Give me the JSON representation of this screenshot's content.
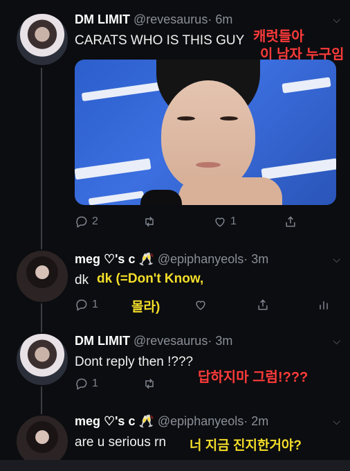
{
  "tweets": [
    {
      "name": "DM LIMIT",
      "handle": "@revesaurus",
      "time": "· 6m",
      "text": "CARATS WHO IS THIS GUY",
      "translation": [
        "캐럿들아",
        "이 남자 누구임"
      ],
      "replies": "2",
      "retweets": "",
      "likes": "1"
    },
    {
      "name": "meg ♡'s c 🥂",
      "handle": "@epiphanyeols",
      "time": "· 3m",
      "text": "dk",
      "translation": [
        "dk (=Don't Know,",
        "몰라)"
      ],
      "replies": "1",
      "retweets": "",
      "likes": ""
    },
    {
      "name": "DM LIMIT",
      "handle": "@revesaurus",
      "time": "· 3m",
      "text": "Dont reply then !???",
      "translation": [
        "답하지마 그럼!???"
      ],
      "replies": "1",
      "retweets": "",
      "likes": ""
    },
    {
      "name": "meg ♡'s c 🥂",
      "handle": "@epiphanyeols",
      "time": "· 2m",
      "text": "are u serious rn",
      "translation": [
        "너 지금 진지한거야?"
      ]
    }
  ],
  "colors": {
    "background": "#0c0d10",
    "red_caption": "#ff3b3b",
    "yellow_caption": "#f5df2a",
    "muted": "#8a8f98"
  },
  "icons": [
    "reply-icon",
    "retweet-icon",
    "like-icon",
    "share-icon",
    "analytics-icon",
    "chevron-down-icon"
  ]
}
